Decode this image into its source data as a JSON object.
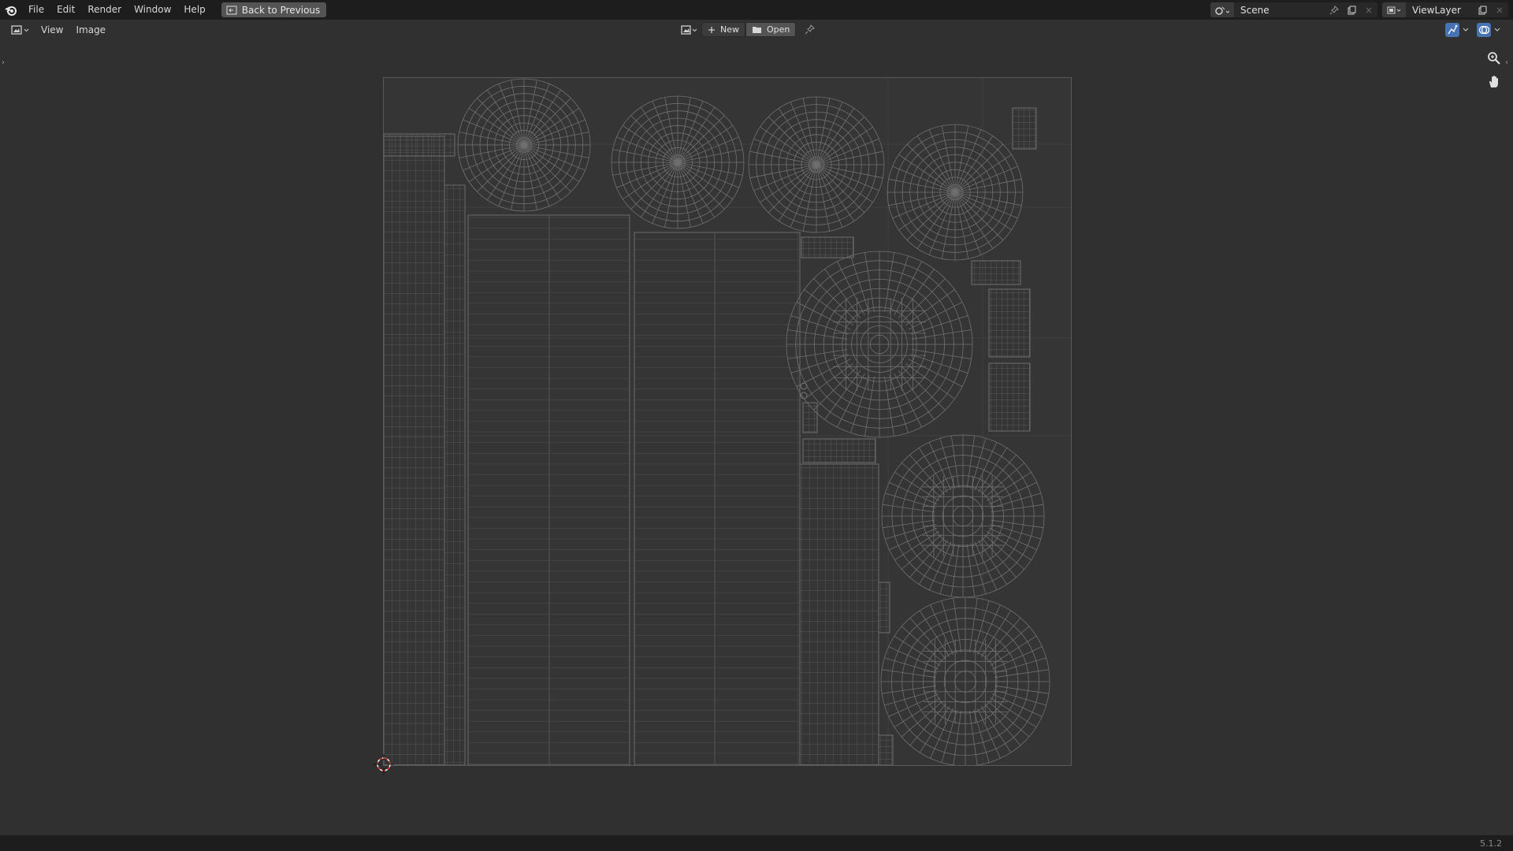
{
  "topbar": {
    "menus": [
      "File",
      "Edit",
      "Render",
      "Window",
      "Help"
    ],
    "back_button": "Back to Previous",
    "scene": "Scene",
    "view_layer": "ViewLayer"
  },
  "editor_header": {
    "menus": [
      "View",
      "Image"
    ],
    "new_label": "New",
    "open_label": "Open"
  },
  "status": {
    "version": "5.1.2"
  },
  "colors": {
    "topbar_bg": "#1d1d1d",
    "editor_bg": "#303030",
    "uv_bg": "#353535",
    "wire": "#6e6e6e",
    "accent": "#4772b3"
  },
  "icons": [
    "blender-logo-icon",
    "back-icon",
    "scene-icon",
    "pin-icon",
    "new-scene-icon",
    "view-layer-icon",
    "image-editor-icon",
    "image-icon",
    "plus-icon",
    "folder-icon",
    "uv-snap-icon",
    "overlay-icon",
    "zoom-icon",
    "hand-icon",
    "cursor-icon"
  ]
}
